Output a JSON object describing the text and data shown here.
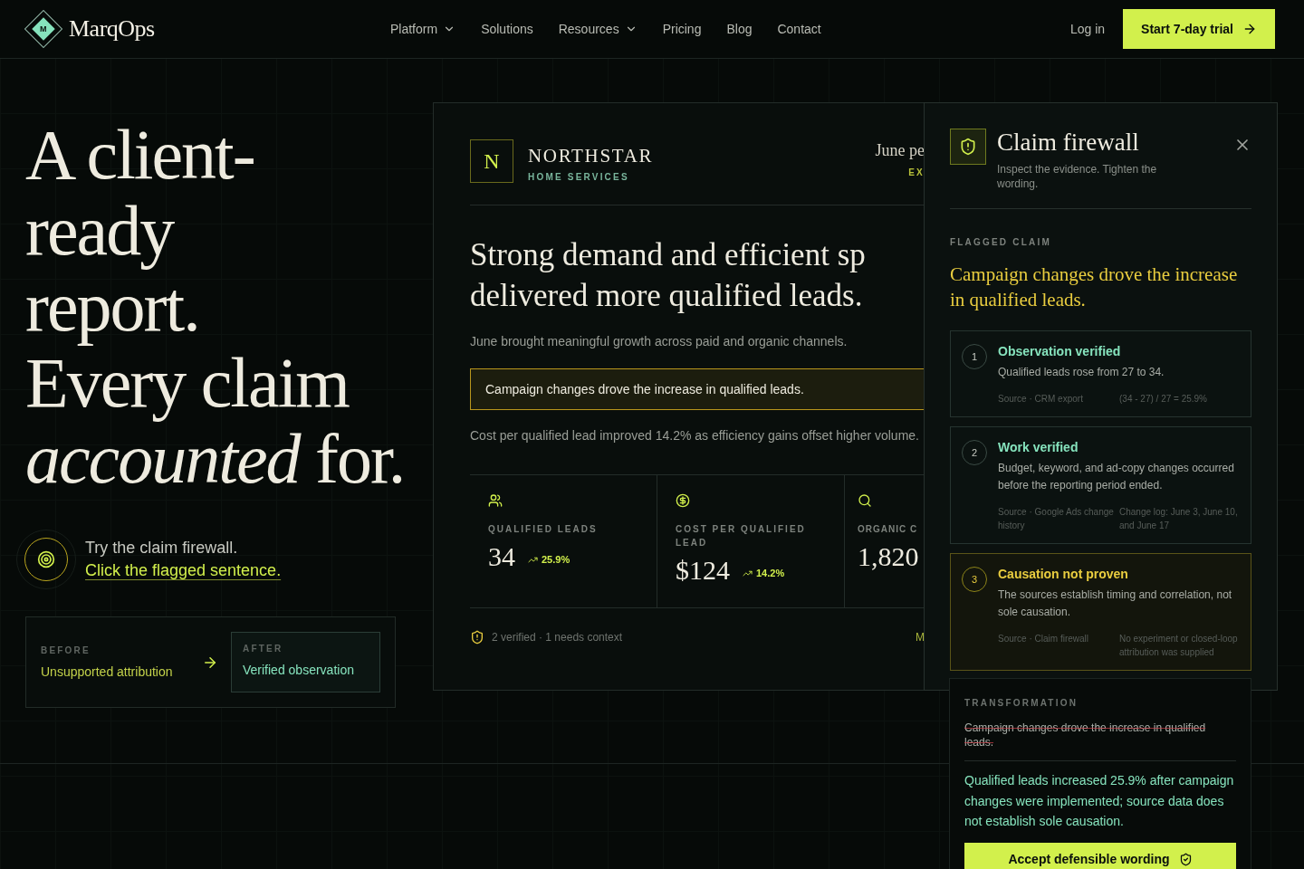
{
  "nav": {
    "brand": "MarqOps",
    "logo_letter": "M",
    "links": [
      {
        "label": "Platform",
        "dropdown": true
      },
      {
        "label": "Solutions",
        "dropdown": false
      },
      {
        "label": "Resources",
        "dropdown": true
      },
      {
        "label": "Pricing",
        "dropdown": false
      },
      {
        "label": "Blog",
        "dropdown": false
      },
      {
        "label": "Contact",
        "dropdown": false
      }
    ],
    "login": "Log in",
    "cta": "Start 7-day trial"
  },
  "hero": {
    "headline_lines": [
      "A client-",
      "ready",
      "report.",
      "Every claim",
      "*accounted* for."
    ],
    "prompt": "Try the claim firewall.",
    "prompt_link": "Click the flagged sentence.",
    "before_label": "BEFORE",
    "before": "Unsupported attribution",
    "after_label": "AFTER",
    "after": "Verified observation"
  },
  "report": {
    "logo_letter": "N",
    "company": "NORTHSTAR",
    "company_sub": "HOME SERVICES",
    "period": "June pe",
    "section": "EX",
    "headline_lines": [
      "Strong demand and efficient sp",
      "delivered more qualified leads."
    ],
    "intro": "June brought meaningful growth across paid and organic channels.",
    "flagged_sentence": {
      "text": "Campaign changes drove the increase in qualified leads.",
      "flagged": true
    },
    "summary": "Cost per qualified lead improved 14.2% as efficiency gains offset higher volume.",
    "stats": [
      {
        "label": "QUALIFIED LEADS",
        "value": "34",
        "delta": "25.9%"
      },
      {
        "label": "COST PER QUALIFIED LEAD",
        "value": "$124",
        "delta": "14.2%"
      },
      {
        "label": "ORGANIC C",
        "value": "1,820"
      }
    ],
    "footer_status": "2 verified · 1 needs context",
    "footer_link": "M"
  },
  "firewall": {
    "title": "Claim firewall",
    "subtitle": "Inspect the evidence. Tighten the wording.",
    "flagged_label": "FLAGGED CLAIM",
    "flagged_claim": "Campaign changes drove the increase in qualified leads.",
    "evidence": [
      {
        "number": "1",
        "kind": "verified",
        "title": "Observation verified",
        "text": "Qualified leads rose from 27 to 34.",
        "source": "Source · CRM export",
        "detail": "(34 - 27) / 27 = 25.9%"
      },
      {
        "number": "2",
        "kind": "verified",
        "title": "Work verified",
        "text": "Budget, keyword, and ad-copy changes occurred before the reporting period ended.",
        "source": "Source · Google Ads change history",
        "detail": "Change log: June 3, June 10, and June 17"
      },
      {
        "number": "3",
        "kind": "not_proven",
        "title": "Causation not proven",
        "text": "The sources establish timing and correlation, not sole causation.",
        "source": "Source · Claim firewall",
        "detail": "No experiment or closed-loop attribution was supplied"
      }
    ],
    "transformation": {
      "label": "TRANSFORMATION",
      "old": "Campaign changes drove the increase in qualified leads.",
      "new": "Qualified leads increased 25.9% after campaign changes were implemented; source data does not establish sole causation.",
      "button": "Accept defensible wording"
    }
  }
}
